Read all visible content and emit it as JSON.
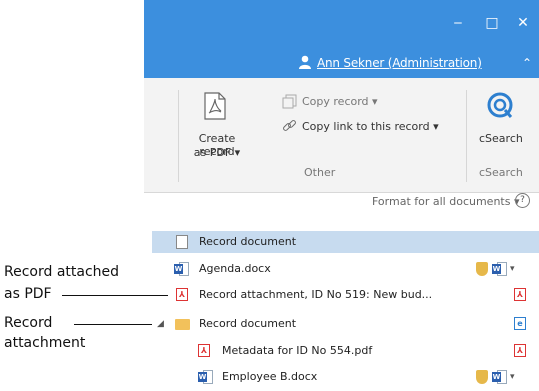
{
  "window": {
    "minimize_glyph": "‒",
    "maximize_glyph": "□",
    "close_glyph": "✕",
    "user_name": "Ann Sekner (Administration)",
    "collapse_glyph": "⌃"
  },
  "ribbon": {
    "create_record_pdf_line1": "Create record",
    "create_record_pdf_line2": "as PDF ▾",
    "copy_record": "Copy record ▾",
    "copy_link": "Copy link to this record ▾",
    "group_other": "Other",
    "csearch_label": "cSearch",
    "group_csearch": "cSearch"
  },
  "toolbar": {
    "format_all": "Format for all documents ▾",
    "help_glyph": "?"
  },
  "documents": [
    {
      "label": "Record document"
    },
    {
      "label": "Agenda.docx"
    },
    {
      "label": "Record attachment, ID No 519: New bud..."
    },
    {
      "label": "Record document",
      "expander": "◢"
    },
    {
      "label": "Metadata for ID No 554.pdf"
    },
    {
      "label": "Employee B.docx"
    }
  ],
  "annotations": {
    "pdf_line1": "Record attached",
    "pdf_line2": "as PDF",
    "att_line1": "Record",
    "att_line2": "attachment"
  },
  "icons": {
    "pdf_glyph": "⅄",
    "word_glyph": "W",
    "edge_glyph": "e",
    "dropdown_glyph": "▾"
  },
  "colors": {
    "titlebar": "#3c8fde",
    "selection": "#c7dbef",
    "pdf_red": "#d33333",
    "folder": "#f2c15b",
    "word_blue": "#2b5fae"
  }
}
